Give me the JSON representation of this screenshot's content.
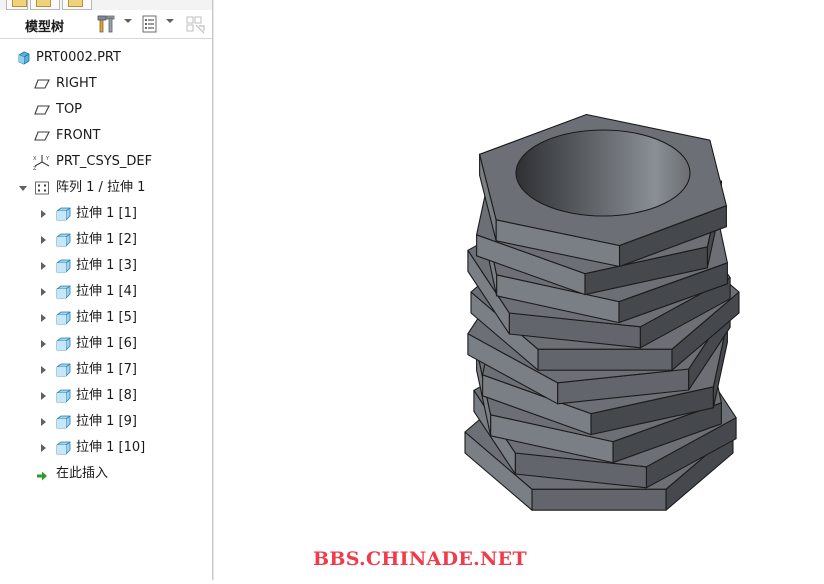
{
  "panel": {
    "title": "模型树",
    "tools": {
      "settings_icon": "tools-icon",
      "show_icon": "tree-filter-icon",
      "columns_icon": "columns-icon"
    }
  },
  "tree": {
    "root": {
      "label": "PRT0002.PRT",
      "icon": "part-icon"
    },
    "datums": [
      {
        "label": "RIGHT",
        "icon": "datum-plane-icon"
      },
      {
        "label": "TOP",
        "icon": "datum-plane-icon"
      },
      {
        "label": "FRONT",
        "icon": "datum-plane-icon"
      },
      {
        "label": "PRT_CSYS_DEF",
        "icon": "csys-icon"
      }
    ],
    "pattern": {
      "label": "阵列 1 / 拉伸 1",
      "icon": "pattern-icon",
      "expanded": true,
      "children": [
        "拉伸 1 [1]",
        "拉伸 1 [2]",
        "拉伸 1 [3]",
        "拉伸 1 [4]",
        "拉伸 1 [5]",
        "拉伸 1 [6]",
        "拉伸 1 [7]",
        "拉伸 1 [8]",
        "拉伸 1 [9]",
        "拉伸 1 [10]"
      ]
    },
    "insert_here": {
      "label": "在此插入",
      "icon": "insert-arrow-icon",
      "color": "#2c9a2c"
    }
  },
  "viewport": {
    "model": "stacked rotated hexagon extrusions with circular pocket",
    "colors": {
      "top": "#6c7076",
      "side_light": "#7a7f85",
      "side_mid": "#62666c",
      "side_dark": "#45484c",
      "edge": "#1b1b1b"
    }
  },
  "watermark": "BBS.CHINADE.NET"
}
